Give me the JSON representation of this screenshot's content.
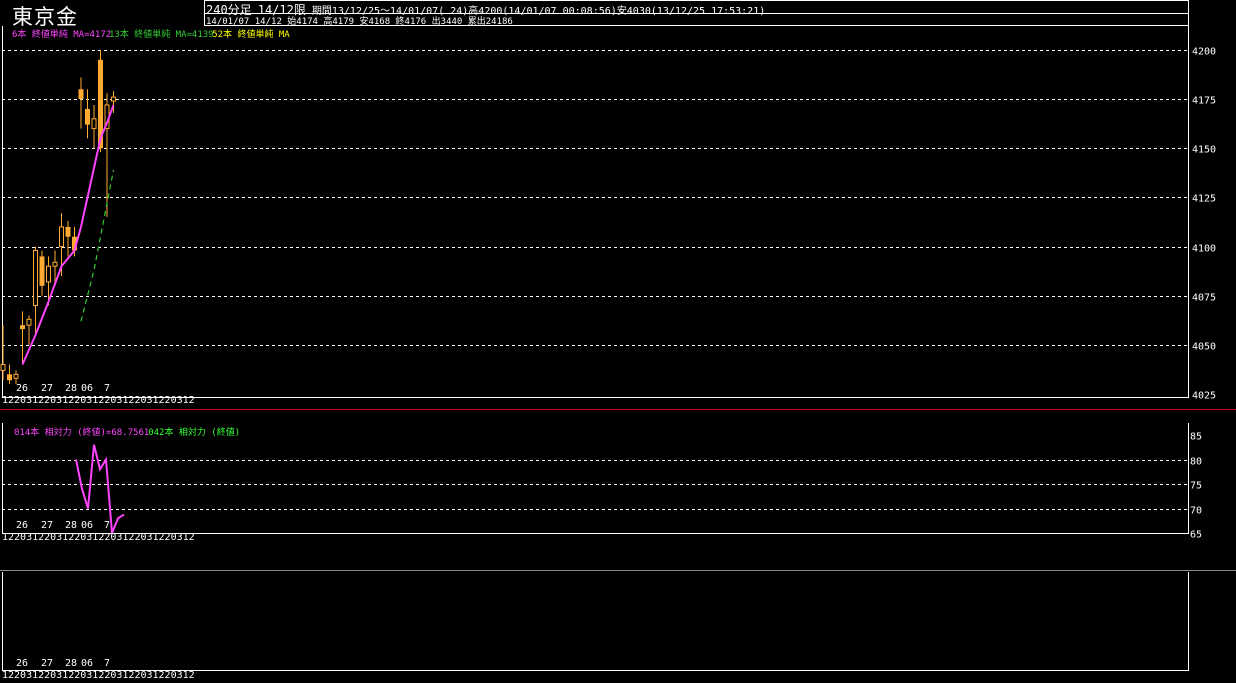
{
  "header": {
    "title": "東京金",
    "timeframe": "240分足",
    "contract": "14/12限",
    "period_info": "期間13/12/25～14/01/07( 24)高4200(14/01/07 00:08:56)安4030(13/12/25 17:53:21)",
    "bar_info": "14/01/07 14/12 始4174 高4179 安4168 終4176 出3440 累出24186"
  },
  "colors": {
    "candle": "#ffaa33",
    "ma6": "#ff44ff",
    "ma13": "#33cc33",
    "ma52": "#ffff00",
    "rsi14": "#ff44ff",
    "rsi42": "#33ff33",
    "separator": "#cc0000"
  },
  "date_labels": [
    "26",
    "27",
    "28",
    "06",
    "7"
  ],
  "time_label_row": "12203122031220312203122031220312",
  "chart_data": [
    {
      "type": "candlestick",
      "legend": [
        {
          "text": "6本 終値単純 MA=4172",
          "color_key": "ma6"
        },
        {
          "text": "13本 終値単純 MA=4139",
          "color_key": "ma13"
        },
        {
          "text": "52本 終値単純 MA",
          "color_key": "ma52"
        }
      ],
      "ylim": [
        4025,
        4210
      ],
      "yticks": [
        4025,
        4050,
        4075,
        4100,
        4125,
        4150,
        4175,
        4200
      ],
      "candles": [
        {
          "o": 4037,
          "h": 4060,
          "l": 4032,
          "c": 4040
        },
        {
          "o": 4035,
          "h": 4040,
          "l": 4030,
          "c": 4032
        },
        {
          "o": 4033,
          "h": 4037,
          "l": 4030,
          "c": 4035
        },
        {
          "o": 4060,
          "h": 4067,
          "l": 4040,
          "c": 4058
        },
        {
          "o": 4060,
          "h": 4065,
          "l": 4050,
          "c": 4063
        },
        {
          "o": 4070,
          "h": 4100,
          "l": 4055,
          "c": 4098
        },
        {
          "o": 4095,
          "h": 4098,
          "l": 4075,
          "c": 4080
        },
        {
          "o": 4082,
          "h": 4095,
          "l": 4070,
          "c": 4090
        },
        {
          "o": 4090,
          "h": 4098,
          "l": 4080,
          "c": 4092
        },
        {
          "o": 4100,
          "h": 4117,
          "l": 4085,
          "c": 4110
        },
        {
          "o": 4110,
          "h": 4113,
          "l": 4095,
          "c": 4105
        },
        {
          "o": 4105,
          "h": 4110,
          "l": 4095,
          "c": 4098
        },
        {
          "o": 4180,
          "h": 4186,
          "l": 4160,
          "c": 4175
        },
        {
          "o": 4170,
          "h": 4180,
          "l": 4155,
          "c": 4162
        },
        {
          "o": 4160,
          "h": 4172,
          "l": 4150,
          "c": 4165
        },
        {
          "o": 4195,
          "h": 4200,
          "l": 4148,
          "c": 4150
        },
        {
          "o": 4160,
          "h": 4178,
          "l": 4115,
          "c": 4172
        },
        {
          "o": 4174,
          "h": 4179,
          "l": 4168,
          "c": 4176
        }
      ],
      "ma6": [
        [
          3,
          4040
        ],
        [
          5,
          4055
        ],
        [
          7,
          4072
        ],
        [
          9,
          4090
        ],
        [
          11,
          4098
        ],
        [
          12,
          4110
        ],
        [
          13,
          4125
        ],
        [
          14,
          4140
        ],
        [
          15,
          4155
        ],
        [
          16,
          4163
        ],
        [
          17,
          4172
        ]
      ],
      "ma13": [
        [
          12,
          4062
        ],
        [
          13,
          4075
        ],
        [
          14,
          4088
        ],
        [
          15,
          4105
        ],
        [
          16,
          4122
        ],
        [
          17,
          4139
        ]
      ]
    },
    {
      "type": "line",
      "legend": [
        {
          "text": "014本 相対力 (終値)=68.7561",
          "color_key": "rsi14"
        },
        {
          "text": "042本 相対力 (終値)",
          "color_key": "rsi42"
        }
      ],
      "ylim": [
        65,
        85
      ],
      "yticks": [
        65,
        70,
        75,
        80,
        85
      ],
      "rsi14": [
        [
          11,
          80
        ],
        [
          12,
          74
        ],
        [
          13,
          70
        ],
        [
          14,
          83
        ],
        [
          15,
          78
        ],
        [
          16,
          80
        ],
        [
          17,
          65
        ],
        [
          18,
          68
        ],
        [
          19,
          68.76
        ]
      ]
    }
  ]
}
